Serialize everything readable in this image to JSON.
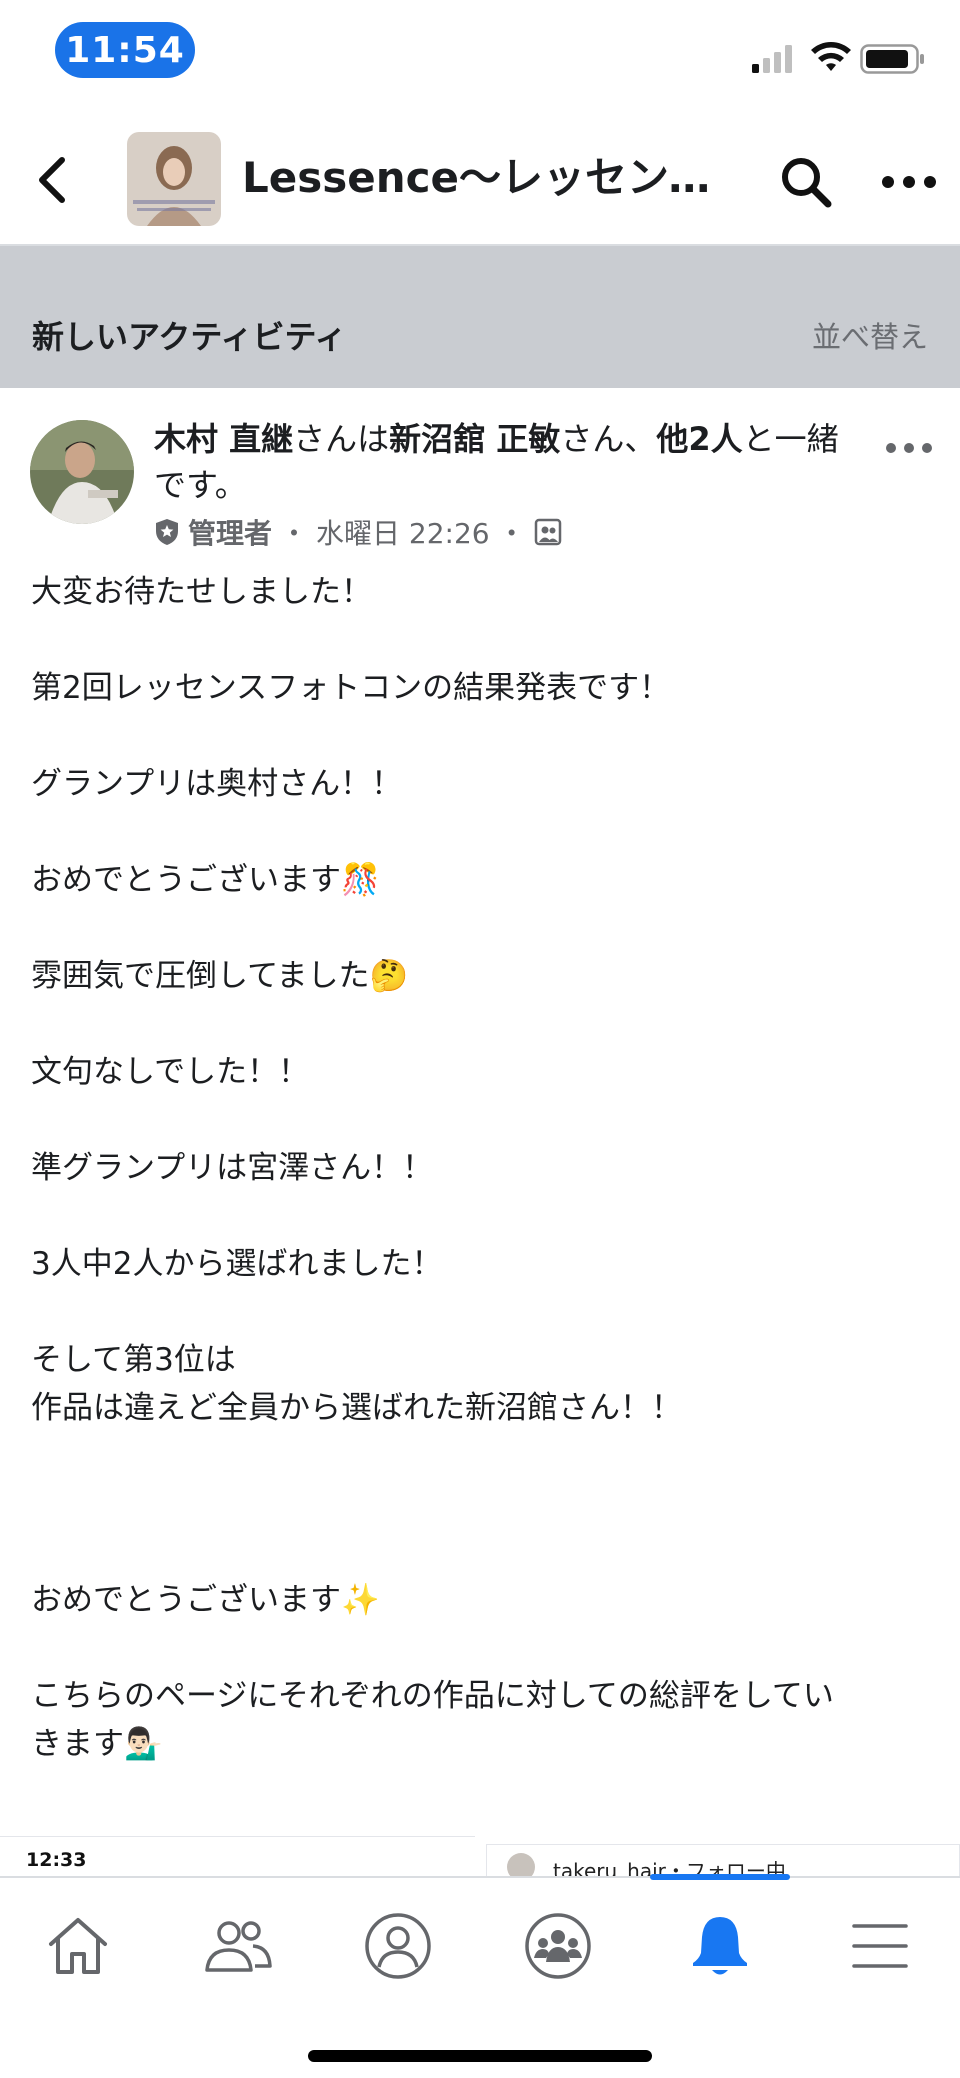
{
  "status_bar": {
    "time": "11:54"
  },
  "header": {
    "title": "Lessence〜レッセンス…"
  },
  "section": {
    "title": "新しいアクティビティ",
    "sort_label": "並べ替え"
  },
  "post": {
    "author": "木村 直継",
    "connector_1": "さんは",
    "tagged_1": "新沼舘 正敏",
    "connector_2": "さん、",
    "tagged_2": "他2人",
    "connector_3": "と一緒です。",
    "role": "管理者",
    "timestamp": "水曜日 22:26",
    "lines": [
      "大変お待たせしました！",
      "",
      "第2回レッセンスフォトコンの結果発表です！",
      "",
      "グランプリは奥村さん！！",
      "",
      "おめでとうございます🎊",
      "",
      "雰囲気で圧倒してました🤔",
      "",
      "文句なしでした！！",
      "",
      "準グランプリは宮澤さん！！",
      "",
      "3人中2人から選ばれました！",
      "",
      "そして第3位は",
      "作品は違えど全員から選ばれた新沼館さん！！",
      "",
      "",
      "",
      "おめでとうございます✨",
      "",
      "こちらのページにそれぞれの作品に対しての総評をしてい",
      "きます💁🏻‍♂️"
    ]
  },
  "embed": {
    "left_time": "12:33",
    "right_user": "takeru_hair・フォロー中"
  },
  "bottom_nav": {
    "items": [
      "home-icon",
      "friends-icon",
      "profile-icon",
      "groups-icon",
      "notifications-icon",
      "menu-icon"
    ],
    "active": "notifications-icon"
  },
  "colors": {
    "accent": "#1877f2",
    "time_pill": "#1a73e8",
    "section_bg": "#c9ccd1"
  }
}
